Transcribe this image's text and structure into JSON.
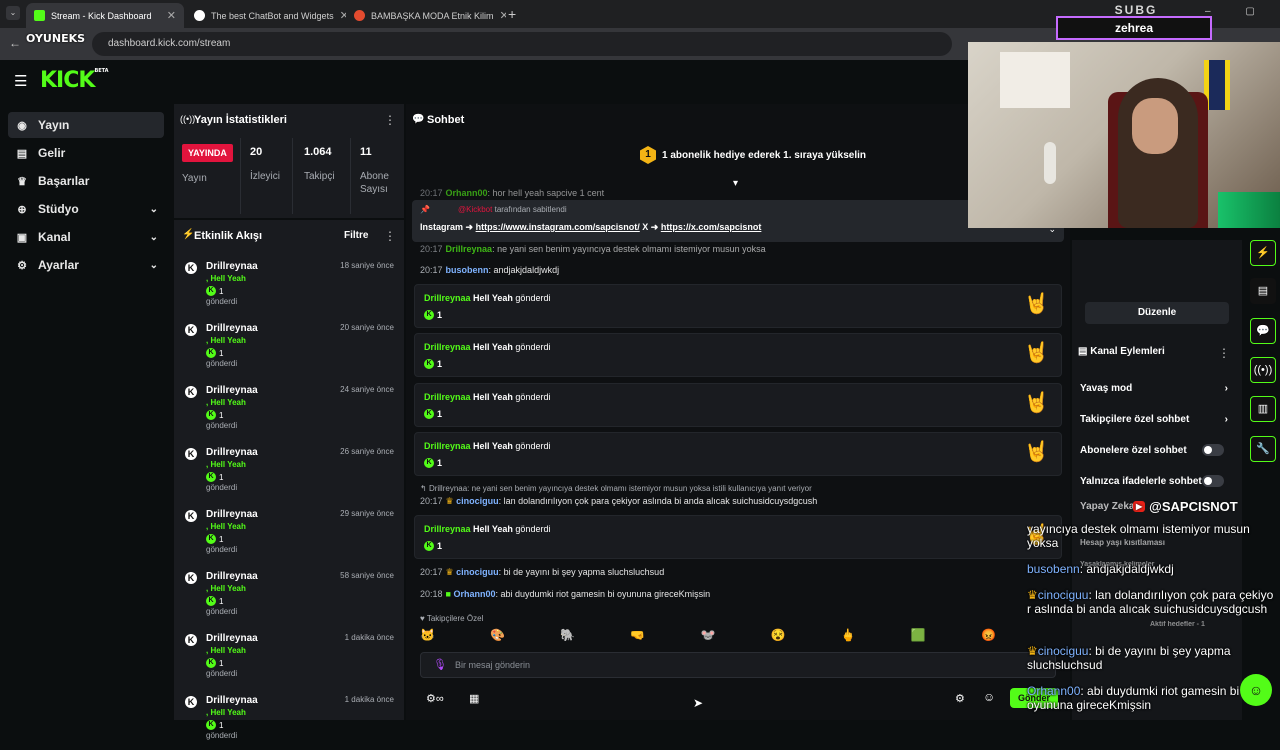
{
  "browser": {
    "tabs": [
      {
        "title": "Stream - Kick Dashboard",
        "color": "#53fc18"
      },
      {
        "title": "The best ChatBot and Widgets",
        "color": "#ffffff"
      },
      {
        "title": "BAMBAŞKA MODA Etnik Kilim",
        "color": "#e34b2f"
      }
    ],
    "url": "dashboard.kick.com/stream",
    "overlay_logo": "OYUNEKS"
  },
  "sidebar": {
    "logo": "KICK",
    "logo_beta": "BETA",
    "items": [
      {
        "label": "Yayın",
        "icon": "broadcast-icon"
      },
      {
        "label": "Gelir",
        "icon": "wallet-icon"
      },
      {
        "label": "Başarılar",
        "icon": "trophy-icon"
      },
      {
        "label": "Stüdyo",
        "icon": "studio-icon"
      },
      {
        "label": "Kanal",
        "icon": "channel-icon"
      },
      {
        "label": "Ayarlar",
        "icon": "gear-icon"
      }
    ]
  },
  "stats": {
    "title": "Yayın İstatistikleri",
    "live_badge": "YAYINDA",
    "live_label": "Yayın",
    "viewers": "20",
    "viewers_label": "İzleyici",
    "followers": "1.064",
    "followers_label": "Takipçi",
    "subs": "11",
    "subs_label": "Abone Sayısı"
  },
  "activity": {
    "title": "Etkinlik Akışı",
    "filter": "Filtre",
    "items": [
      {
        "name": "Drillreynaa",
        "gift": ", Hell Yeah",
        "count": "1",
        "sent": "gönderdi",
        "time": "18 saniye önce"
      },
      {
        "name": "Drillreynaa",
        "gift": ", Hell Yeah",
        "count": "1",
        "sent": "gönderdi",
        "time": "20 saniye önce"
      },
      {
        "name": "Drillreynaa",
        "gift": ", Hell Yeah",
        "count": "1",
        "sent": "gönderdi",
        "time": "24 saniye önce"
      },
      {
        "name": "Drillreynaa",
        "gift": ", Hell Yeah",
        "count": "1",
        "sent": "gönderdi",
        "time": "26 saniye önce"
      },
      {
        "name": "Drillreynaa",
        "gift": ", Hell Yeah",
        "count": "1",
        "sent": "gönderdi",
        "time": "29 saniye önce"
      },
      {
        "name": "Drillreynaa",
        "gift": ", Hell Yeah",
        "count": "1",
        "sent": "gönderdi",
        "time": "58 saniye önce"
      },
      {
        "name": "Drillreynaa",
        "gift": ", Hell Yeah",
        "count": "1",
        "sent": "gönderdi",
        "time": "1 dakika önce"
      },
      {
        "name": "Drillreynaa",
        "gift": ", Hell Yeah",
        "count": "1",
        "sent": "gönderdi",
        "time": "1 dakika önce"
      }
    ]
  },
  "chat": {
    "title": "Sohbet",
    "sub_goal": "1 abonelik hediye ederek 1. sıraya yükselin",
    "sub_goal_rank": "1",
    "pinned_by": "@Kickbot",
    "pinned_suffix": "tarafından sabitlendi",
    "pinned_prefix": "Instagram ➜",
    "pinned_insta": "https://www.instagram.com/sapcisnot/",
    "pinned_mid": " X ➜",
    "pinned_x": "https://x.com/sapcisnot",
    "line_top_time": "20:17",
    "line_top_user": "Orhann00",
    "line_top_text": ": hor hell yeah sapcive 1 cent",
    "line_partial_time": "20:17",
    "line_partial_user": "Drillreynaa",
    "line_partial_text": ": ne yani sen benim yayıncıya destek olmamı istemiyor musun yoksa",
    "line1_time": "20:17",
    "line1_user": "busobenn",
    "line1_text": ": andjakjdaldjwkdj",
    "gift_who": "Drillreynaa",
    "gift_what": "Hell Yeah",
    "gift_verb": "gönderdi",
    "gift_count": "1",
    "reply_ref": "Drillreynaa: ne yani sen benim yayıncıya destek olmamı istemiyor musun yoksa istili kullanıcıya yanıt veriyor",
    "line2_time": "20:17",
    "line2_user": "cinociguu",
    "line2_text": ": lan dolandırılıyon çok para çekiyor aslında bi anda alıcak suichusidcuysdgcush",
    "line3_time": "20:17",
    "line3_user": "cinociguu",
    "line3_text": ": bi de yayını bi şey yapma sluchsluchsud",
    "line4_time": "20:18",
    "line4_user": "Orhann00",
    "line4_text": ": abi duydumki riot gamesin bi oyununa gireceKmişsin",
    "emote_tab": "Takipçilere Özel",
    "input_placeholder": "Bir mesaj gönderin",
    "send": "Gönder"
  },
  "right": {
    "edit": "Düzenle",
    "actions_title": "Kanal Eylemleri",
    "rows": [
      {
        "label": "Yavaş mod",
        "kind": "arrow"
      },
      {
        "label": "Takipçilere özel sohbet",
        "kind": "arrow"
      },
      {
        "label": "Abonelere özel sohbet",
        "kind": "toggle"
      },
      {
        "label": "Yalnızca ifadelerle sohbet",
        "kind": "toggle"
      }
    ],
    "partial_1": "Yapay Zeka",
    "partial_2": "Hesap yaşı kısıtlaması",
    "partial_3": "Yasaklanmış kelimeler",
    "partial_4": "Aktif hedefler - 1"
  },
  "overlay": {
    "cam_title": "SUBG",
    "cam_name": "zehrea",
    "social": "@SAPCISNOT",
    "msg1": "yayıncıya destek olmamı istemiyor musun yoksa",
    "msg2_user": "busobenn",
    "msg2_text": ": andjakjdaldjwkdj",
    "msg3_user": "cinociguu",
    "msg3_text": ": lan dolandırılıyon çok para çekiyor aslında bi anda alıcak suichusidcuysdgcush",
    "msg4_user": "cinociguu",
    "msg4_text": ": bi de yayını bi şey yapma sluchsluchsud",
    "msg5_user": "Orhann00",
    "msg5_text": ": abi duydumki riot gamesin bi oyununa gireceKmişsin"
  }
}
